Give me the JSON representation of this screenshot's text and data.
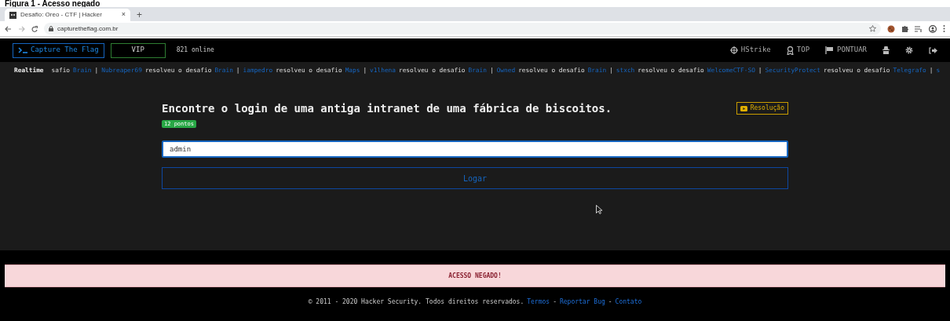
{
  "caption": "Figura 1 - Acesso negado",
  "browser": {
    "tab_title": "Desafio: Oreo - CTF | Hacker",
    "tab_close": "×",
    "new_tab": "+",
    "url": "capturetheflag.com.br"
  },
  "nav": {
    "brand": "Capture The Flag",
    "vip": "VIP",
    "online": "821 online",
    "links": [
      {
        "label": "HStrike",
        "kind": "target"
      },
      {
        "label": "TOP",
        "kind": "award"
      },
      {
        "label": "PONTUAR",
        "kind": "flag"
      }
    ]
  },
  "ticker": {
    "label": "Realtime",
    "items": [
      {
        "text": "safio",
        "kind": "plain"
      },
      {
        "text": "Brain",
        "kind": "link"
      },
      {
        "text": "|",
        "kind": "plain"
      },
      {
        "text": "Nubreaper69",
        "kind": "link"
      },
      {
        "text": "resolveu o desafio",
        "kind": "plain"
      },
      {
        "text": "Brain",
        "kind": "link"
      },
      {
        "text": "|",
        "kind": "plain"
      },
      {
        "text": "iampedro",
        "kind": "link"
      },
      {
        "text": "resolveu o desafio",
        "kind": "plain"
      },
      {
        "text": "Maps",
        "kind": "link"
      },
      {
        "text": "|",
        "kind": "plain"
      },
      {
        "text": "v1lhena",
        "kind": "link"
      },
      {
        "text": "resolveu o desafio",
        "kind": "plain"
      },
      {
        "text": "Brain",
        "kind": "link"
      },
      {
        "text": "|",
        "kind": "plain"
      },
      {
        "text": "Owned",
        "kind": "link"
      },
      {
        "text": "resolveu o desafio",
        "kind": "plain"
      },
      {
        "text": "Brain",
        "kind": "link"
      },
      {
        "text": "|",
        "kind": "plain"
      },
      {
        "text": "stxch",
        "kind": "link"
      },
      {
        "text": "resolveu o desafio",
        "kind": "plain"
      },
      {
        "text": "WelcomeCTF-SO",
        "kind": "link"
      },
      {
        "text": "|",
        "kind": "plain"
      },
      {
        "text": "SecurityProtect",
        "kind": "link"
      },
      {
        "text": "resolveu o desafio",
        "kind": "plain"
      },
      {
        "text": "Telegrafo",
        "kind": "link"
      },
      {
        "text": "|",
        "kind": "plain"
      },
      {
        "text": "s",
        "kind": "link"
      }
    ]
  },
  "challenge": {
    "title": "Encontre o login de uma antiga intranet de uma fábrica de biscoitos.",
    "points": "12 pontos",
    "resolution": "Resolução",
    "input_value": "admin",
    "submit": "Logar"
  },
  "alert": "ACESSO NEGADO!",
  "footer": {
    "copyright": "© 2011 - 2020 Hacker Security. Todos direitos reservados.",
    "links": [
      {
        "text": "Termos",
        "kind": "link"
      },
      {
        "text": "-",
        "kind": "plain"
      },
      {
        "text": "Reportar Bug",
        "kind": "link"
      },
      {
        "text": "-",
        "kind": "plain"
      },
      {
        "text": "Contato",
        "kind": "link"
      }
    ]
  }
}
